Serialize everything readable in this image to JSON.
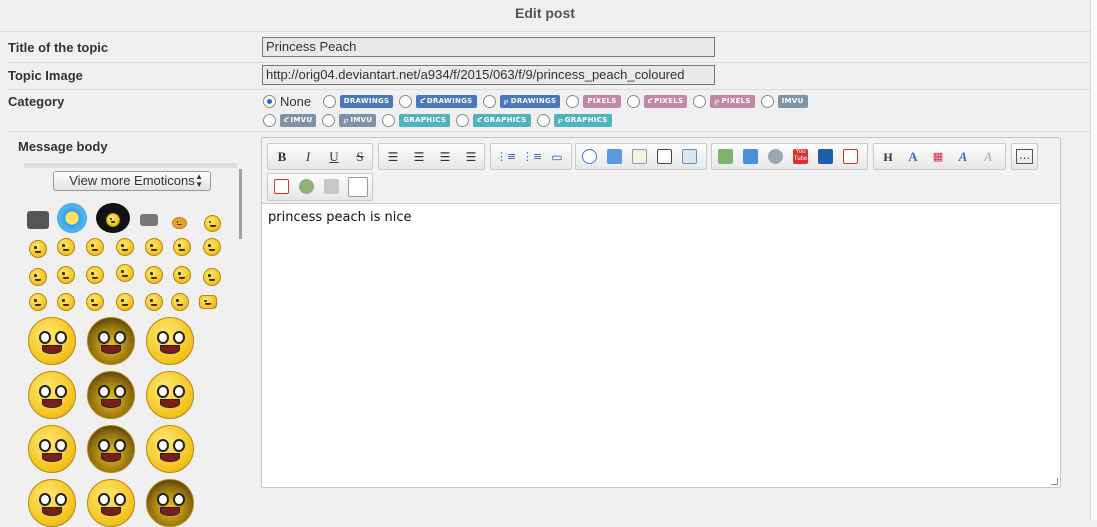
{
  "header": {
    "title": "Edit post"
  },
  "fields": {
    "title_label": "Title of the topic",
    "title_value": "Princess Peach",
    "image_label": "Topic Image",
    "image_value": "http://orig04.deviantart.net/a934/f/2015/063/f/9/princess_peach_coloured",
    "category_label": "Category",
    "message_label": "Message body"
  },
  "categories": {
    "none_label": "None",
    "row1": [
      {
        "tag": "DRAWINGS",
        "prefix": "",
        "color": "#4a78b8"
      },
      {
        "tag": "DRAWINGS",
        "prefix": "ƈ",
        "color": "#4a78b8"
      },
      {
        "tag": "DRAWINGS",
        "prefix": "℘",
        "color": "#4a78b8"
      },
      {
        "tag": "PIXELS",
        "prefix": "",
        "color": "#c08aa6"
      },
      {
        "tag": "PIXELS",
        "prefix": "ƈ",
        "color": "#c08aa6"
      },
      {
        "tag": "PIXELS",
        "prefix": "℘",
        "color": "#c08aa6"
      },
      {
        "tag": "IMVU",
        "prefix": "",
        "color": "#7f93a6"
      }
    ],
    "row2": [
      {
        "tag": "IMVU",
        "prefix": "ƈ",
        "color": "#7f93a6"
      },
      {
        "tag": "IMVU",
        "prefix": "℘",
        "color": "#7f93a6"
      },
      {
        "tag": "GRAPHICS",
        "prefix": "",
        "color": "#4fb3c2"
      },
      {
        "tag": "GRAPHICS",
        "prefix": "ƈ",
        "color": "#4fb3c2"
      },
      {
        "tag": "GRAPHICS",
        "prefix": "℘",
        "color": "#4fb3c2"
      }
    ]
  },
  "emoticons": {
    "select_label": "View more Emoticons"
  },
  "editor": {
    "content": "princess peach is nice",
    "toolbar": {
      "bold": "B",
      "italic": "I",
      "underline": "U",
      "strike": "S",
      "heading": "H"
    }
  }
}
